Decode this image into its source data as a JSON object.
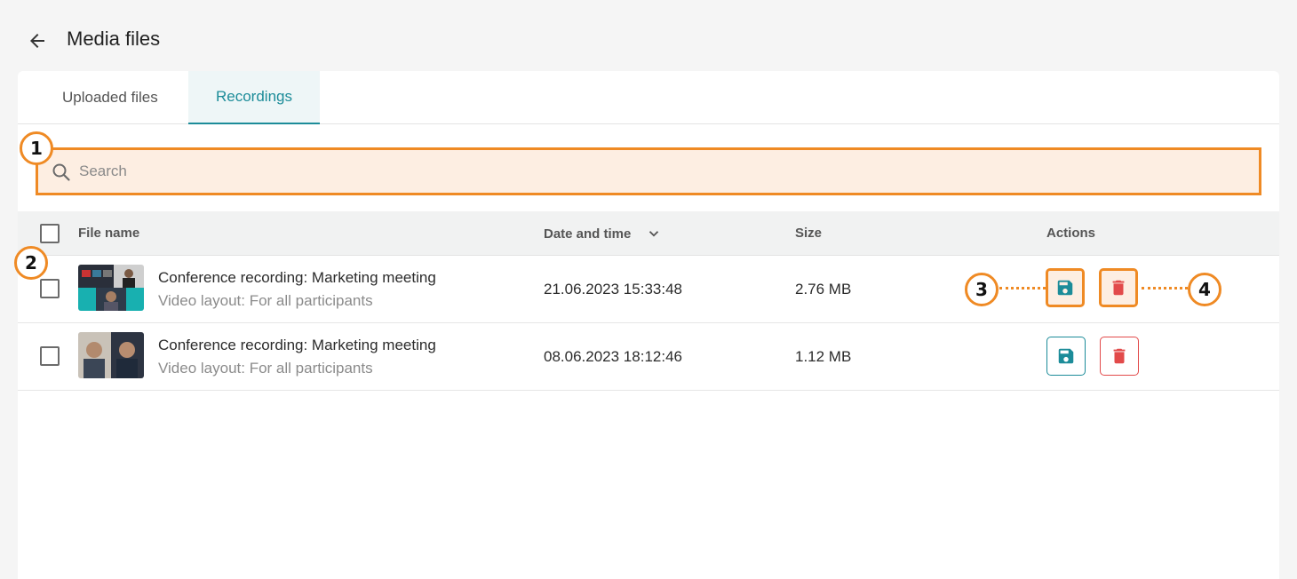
{
  "header": {
    "title": "Media files"
  },
  "tabs": [
    {
      "label": "Uploaded files",
      "active": false
    },
    {
      "label": "Recordings",
      "active": true
    }
  ],
  "search": {
    "placeholder": "Search",
    "value": ""
  },
  "table": {
    "columns": {
      "file_name": "File name",
      "date_time": "Date and time",
      "size": "Size",
      "actions": "Actions"
    },
    "rows": [
      {
        "title": "Conference recording: Marketing meeting",
        "subtitle": "Video layout: For all participants",
        "datetime": "21.06.2023 15:33:48",
        "size": "2.76 MB"
      },
      {
        "title": "Conference recording: Marketing meeting",
        "subtitle": "Video layout: For all participants",
        "datetime": "08.06.2023 18:12:46",
        "size": "1.12 MB"
      }
    ]
  },
  "annotations": {
    "m1": "1",
    "m2": "2",
    "m3": "3",
    "m4": "4"
  },
  "colors": {
    "accent": "#1c8c99",
    "delete": "#e24a4a",
    "highlight": "#ef8a24",
    "highlight_bg": "#fdeee2"
  },
  "icons": {
    "back": "arrow-left-icon",
    "search": "search-icon",
    "save": "floppy-disk-icon",
    "delete": "trash-icon",
    "sort": "chevron-down-icon"
  }
}
